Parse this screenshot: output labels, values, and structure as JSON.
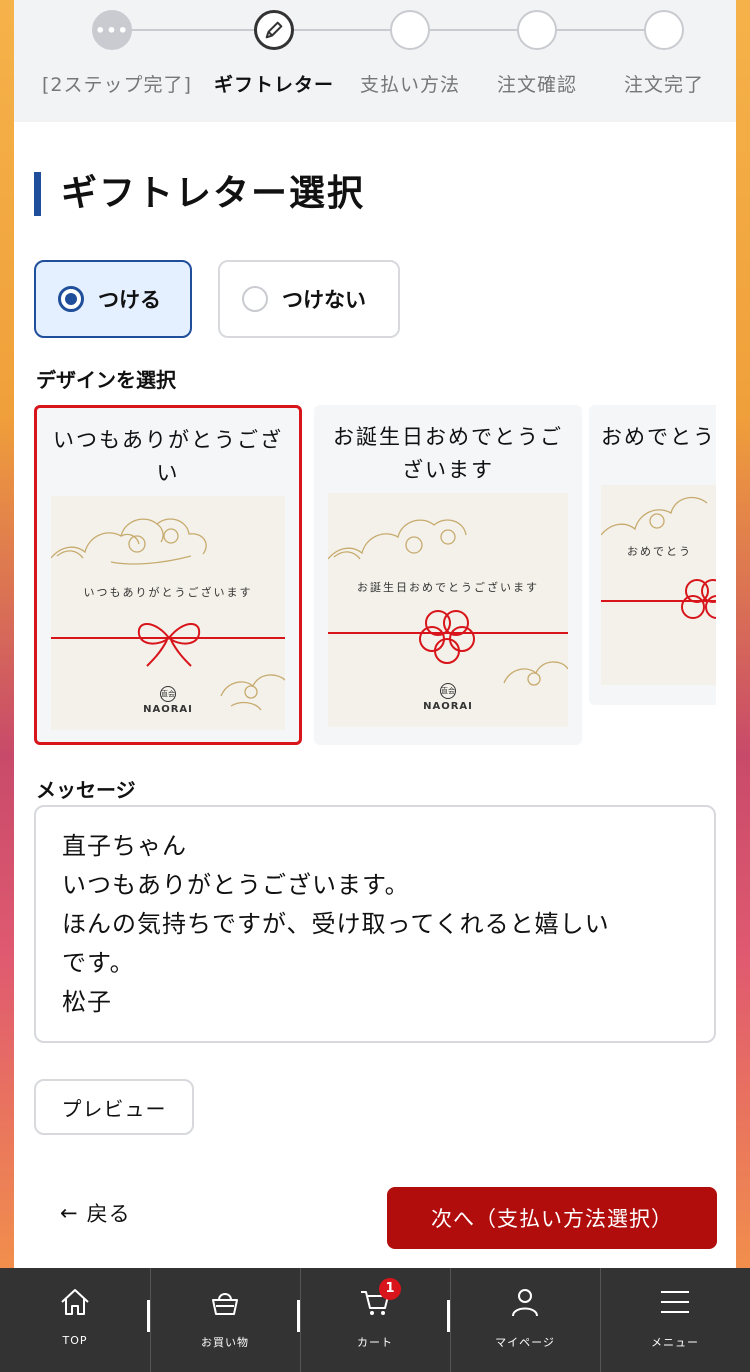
{
  "stepper": {
    "steps": [
      {
        "label": "[2ステップ完了]",
        "state": "done",
        "icon": "ellipsis-icon"
      },
      {
        "label": "ギフトレター",
        "state": "current",
        "icon": "pencil-icon"
      },
      {
        "label": "支払い方法",
        "state": "todo"
      },
      {
        "label": "注文確認",
        "state": "todo"
      },
      {
        "label": "注文完了",
        "state": "todo"
      }
    ]
  },
  "title": "ギフトレター選択",
  "options": {
    "attach": "つける",
    "no_attach": "つけない",
    "selected": "attach"
  },
  "design_heading": "デザインを選択",
  "designs": [
    {
      "title": "いつもありがとうござい\nます",
      "card_text": "いつもありがとうございます",
      "selected": true,
      "motif": "ribbon"
    },
    {
      "title": "お誕生日おめでとうご\nざいます",
      "card_text": "お誕生日おめでとうございます",
      "selected": false,
      "motif": "plum-knot"
    },
    {
      "title": "おめでとう",
      "card_text": "おめでとう",
      "selected": false,
      "motif": "plum-knot"
    }
  ],
  "brand": {
    "name": "NAORAI",
    "kanji": "直会"
  },
  "message_heading": "メッセージ",
  "message": "直子ちゃん\nいつもありがとうございます。\nほんの気持ちですが、受け取ってくれると嬉しい\nです。\n松子",
  "buttons": {
    "preview": "プレビュー",
    "back": "戻る",
    "back_arrow": "←",
    "next": "次へ（支払い方法選択）"
  },
  "tabbar": [
    {
      "label": "TOP",
      "icon": "home-icon"
    },
    {
      "label": "お買い物",
      "icon": "basket-icon"
    },
    {
      "label": "カート",
      "icon": "cart-icon",
      "badge": "1"
    },
    {
      "label": "マイページ",
      "icon": "person-icon"
    },
    {
      "label": "メニュー",
      "icon": "menu-icon"
    }
  ],
  "colors": {
    "accent_blue": "#1f4e9a",
    "primary_red": "#b20d0d",
    "selected_border": "#d8151a",
    "tabbar_bg": "#333333"
  }
}
